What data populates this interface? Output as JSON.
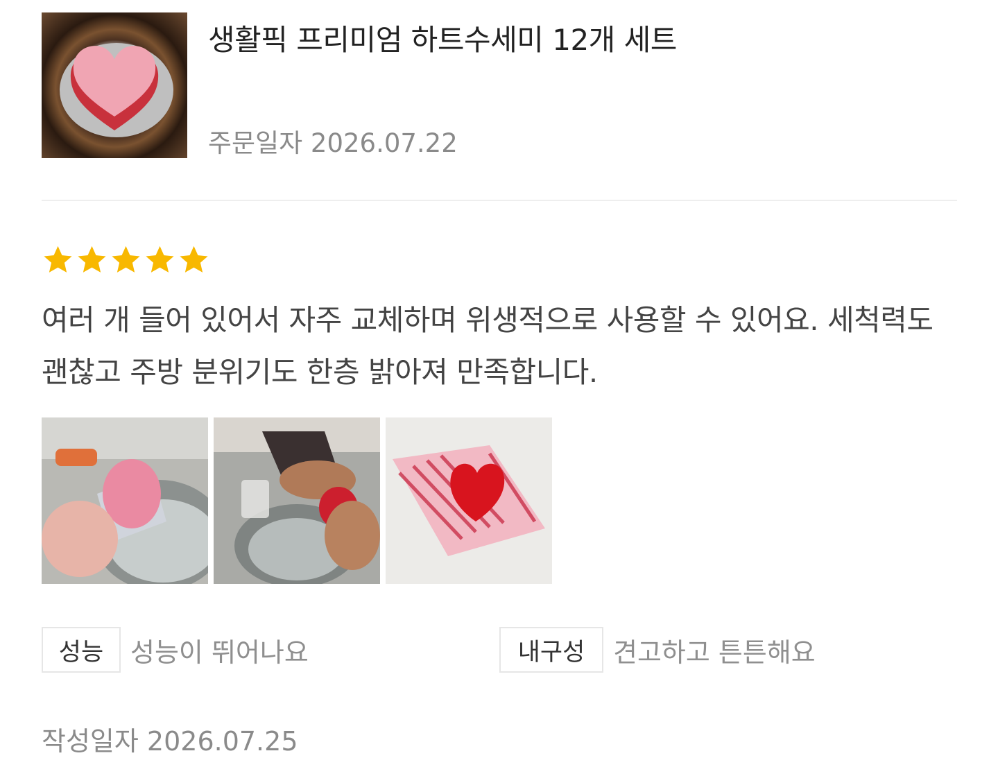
{
  "product": {
    "title": "생활픽 프리미엄 하트수세미 12개 세트",
    "order_date": "주문일자 2026.07.22",
    "thumbnail_icon": "heart-sponge-image"
  },
  "review": {
    "rating": 5,
    "max_rating": 5,
    "star_color": "#f8b800",
    "text": "여러 개 들어 있어서 자주 교체하며 위생적으로 사용할 수 있어요. 세척력도 괜찮고 주방 분위기도 한층 밝아져 만족합니다.",
    "photos": [
      "sink-sponge-photo",
      "hand-washing-photo",
      "sponge-package-photo"
    ]
  },
  "attributes": [
    {
      "label": "성능",
      "value": "성능이 뛰어나요"
    },
    {
      "label": "내구성",
      "value": "견고하고 튼튼해요"
    }
  ],
  "written_date": "작성일자 2026.07.25"
}
